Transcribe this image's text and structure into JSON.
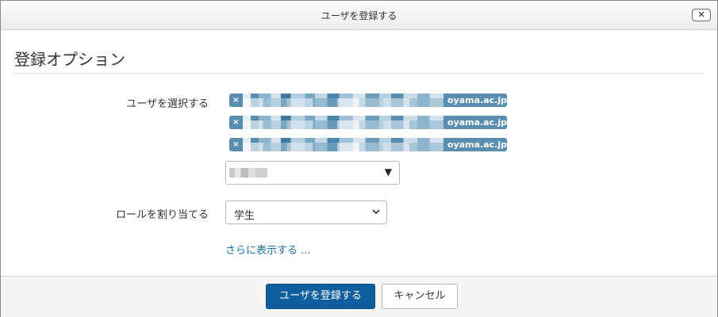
{
  "dialog": {
    "title": "ユーザを登録する",
    "close_label": "✕"
  },
  "section": {
    "heading": "登録オプション"
  },
  "users": {
    "label": "ユーザを選択する",
    "chips": [
      {
        "remove_label": "×",
        "domain_suffix": "oyama.ac.jp"
      },
      {
        "remove_label": "×",
        "domain_suffix": "oyama.ac.jp"
      },
      {
        "remove_label": "×",
        "domain_suffix": "oyama.ac.jp"
      }
    ],
    "search_arrow": "▼"
  },
  "role": {
    "label": "ロールを割り当てる",
    "selected": "学生"
  },
  "more_link": "さらに表示する ...",
  "footer": {
    "submit_label": "ユーザを登録する",
    "cancel_label": "キャンセル"
  },
  "colors": {
    "accent": "#0f5fa0",
    "chip": "#5a8eb0",
    "link": "#1e6fa8"
  }
}
